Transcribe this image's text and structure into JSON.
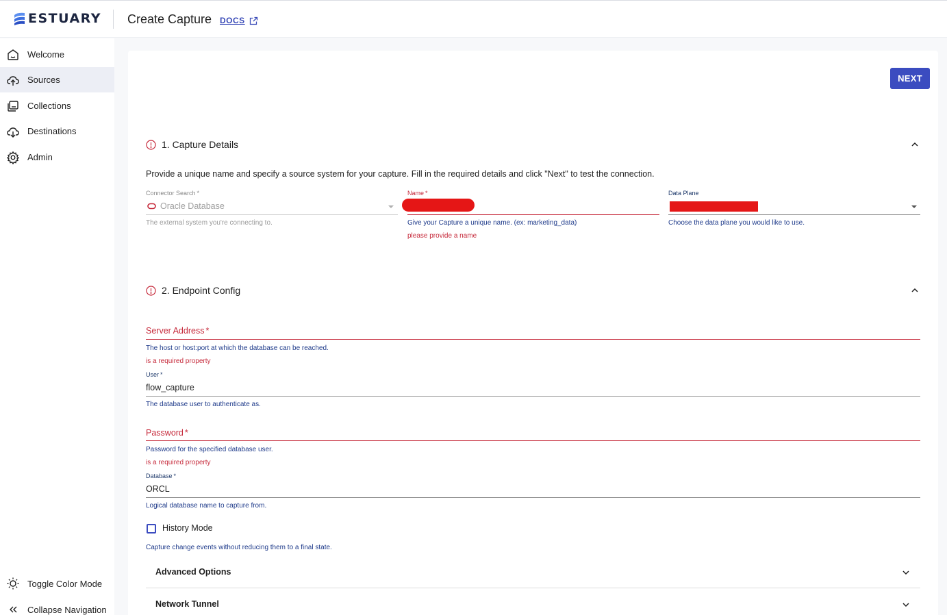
{
  "brand": {
    "logo_text": "ESTUARY"
  },
  "header": {
    "title": "Create Capture",
    "docs_label": "DOCS"
  },
  "sidebar": {
    "items": [
      {
        "label": "Welcome",
        "icon": "home-icon"
      },
      {
        "label": "Sources",
        "icon": "cloud-upload-icon",
        "active": true
      },
      {
        "label": "Collections",
        "icon": "collections-icon"
      },
      {
        "label": "Destinations",
        "icon": "cloud-download-icon"
      },
      {
        "label": "Admin",
        "icon": "gear-icon"
      }
    ],
    "bottom": [
      {
        "label": "Toggle Color Mode",
        "icon": "sun-icon"
      },
      {
        "label": "Collapse Navigation",
        "icon": "double-chevron-left-icon"
      }
    ]
  },
  "actions": {
    "next_label": "NEXT"
  },
  "capture_details": {
    "heading": "1. Capture Details",
    "description": "Provide a unique name and specify a source system for your capture. Fill in the required details and click \"Next\" to test the connection.",
    "connector": {
      "label": "Connector Search",
      "value": "Oracle Database",
      "helper": "The external system you're connecting to."
    },
    "name": {
      "label": "Name",
      "value": "",
      "helper": "Give your Capture a unique name. (ex: marketing_data)",
      "error": "please provide a name"
    },
    "data_plane": {
      "label": "Data Plane",
      "helper": "Choose the data plane you would like to use."
    }
  },
  "endpoint_config": {
    "heading": "2. Endpoint Config",
    "server_address": {
      "label": "Server Address",
      "value": "",
      "helper": "The host or host:port at which the database can be reached.",
      "error": "is a required property"
    },
    "user": {
      "label": "User",
      "value": "flow_capture",
      "helper": "The database user to authenticate as."
    },
    "password": {
      "label": "Password",
      "value": "",
      "helper": "Password for the specified database user.",
      "error": "is a required property"
    },
    "database": {
      "label": "Database",
      "value": "ORCL",
      "helper": "Logical database name to capture from."
    },
    "history_mode": {
      "label": "History Mode",
      "checked": false,
      "helper": "Capture change events without reducing them to a final state."
    },
    "advanced_options": {
      "label": "Advanced Options"
    },
    "network_tunnel": {
      "label": "Network Tunnel"
    }
  },
  "colors": {
    "accent": "#3b4cc0",
    "error": "#c62a3b",
    "helper": "#1e3a8a",
    "redaction": "#e51616"
  }
}
